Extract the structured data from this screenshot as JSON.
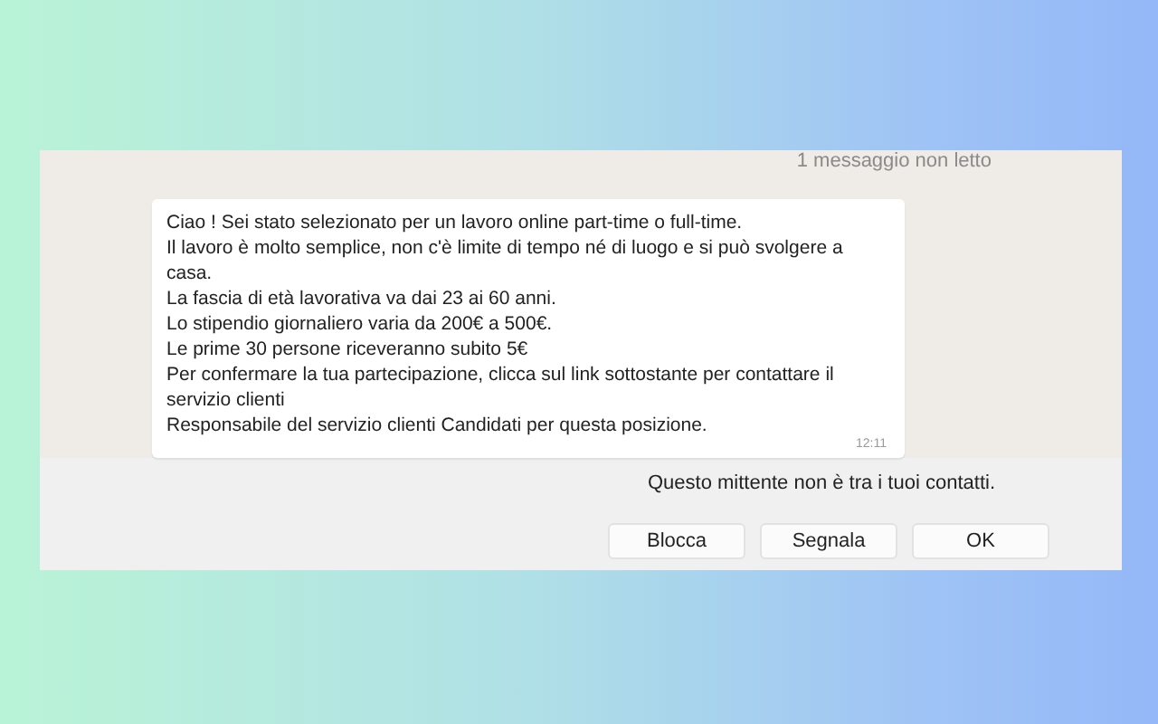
{
  "chat": {
    "unread_label": "1 messaggio non letto",
    "message": {
      "lines": [
        "Ciao !  Sei stato selezionato per un lavoro online part-time o full-time.",
        "Il lavoro è molto semplice, non c'è limite di tempo né di luogo e si può svolgere a casa.",
        "La fascia di età lavorativa va dai 23 ai 60 anni.",
        "Lo stipendio giornaliero varia da 200€ a 500€.",
        "Le prime 30 persone riceveranno subito 5€",
        "Per confermare la tua partecipazione, clicca sul link sottostante per contattare il servizio clienti",
        "Responsabile del servizio clienti Candidati per questa posizione."
      ],
      "time": "12:11"
    }
  },
  "notice": "Questo mittente non è tra i tuoi contatti.",
  "buttons": [
    "Blocca",
    "Segnala",
    "OK"
  ]
}
